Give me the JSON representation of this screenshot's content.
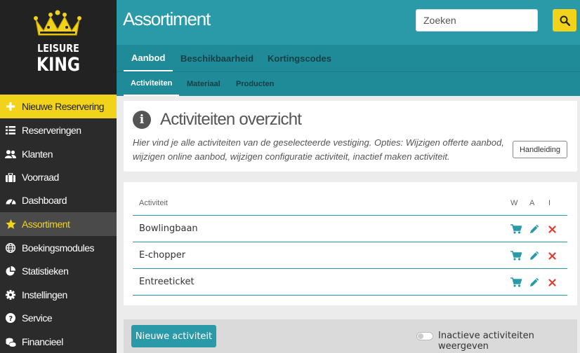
{
  "logo": {
    "line1": "LEISURE",
    "line2": "KING"
  },
  "sidebar": {
    "items": [
      {
        "label": "Nieuwe Reservering",
        "icon": "plus-icon"
      },
      {
        "label": "Reserveringen",
        "icon": "list-icon"
      },
      {
        "label": "Klanten",
        "icon": "users-icon"
      },
      {
        "label": "Voorraad",
        "icon": "suitcase-icon"
      },
      {
        "label": "Dashboard",
        "icon": "gauge-icon"
      },
      {
        "label": "Assortiment",
        "icon": "star-icon"
      },
      {
        "label": "Boekingsmodules",
        "icon": "globe-icon"
      },
      {
        "label": "Statistieken",
        "icon": "pie-chart-icon"
      },
      {
        "label": "Instellingen",
        "icon": "gear-icon"
      },
      {
        "label": "Service",
        "icon": "question-icon"
      },
      {
        "label": "Financieel",
        "icon": "coins-icon"
      }
    ]
  },
  "header": {
    "title": "Assortiment",
    "search_placeholder": "Zoeken"
  },
  "tabs": [
    {
      "label": "Aanbod"
    },
    {
      "label": "Beschikbaarheid"
    },
    {
      "label": "Kortingscodes"
    }
  ],
  "subtabs": [
    {
      "label": "Activiteiten"
    },
    {
      "label": "Materiaal"
    },
    {
      "label": "Producten"
    }
  ],
  "info": {
    "title": "Activiteiten overzicht",
    "description": "Hier vind je alle activiteiten van de geselecteerde vestiging. Opties: Wijzigen offerte aanbod, wijzigen online aanbod, wijzigen configuratie activiteit, inactief maken activiteit.",
    "help_button": "Handleiding"
  },
  "table": {
    "columns": {
      "name": "Activiteit",
      "w": "W",
      "a": "A",
      "i": "I"
    },
    "rows": [
      {
        "name": "Bowlingbaan"
      },
      {
        "name": "E-chopper"
      },
      {
        "name": "Entreeticket"
      }
    ]
  },
  "footer": {
    "new_button": "Nieuwe activiteit",
    "toggle_label": "Inactieve activiteiten weergeven"
  },
  "colors": {
    "teal": "#2a9aa8",
    "accent_yellow": "#f0d31a",
    "sidebar": "#2b2b2b",
    "delete_red": "#e03c31"
  }
}
